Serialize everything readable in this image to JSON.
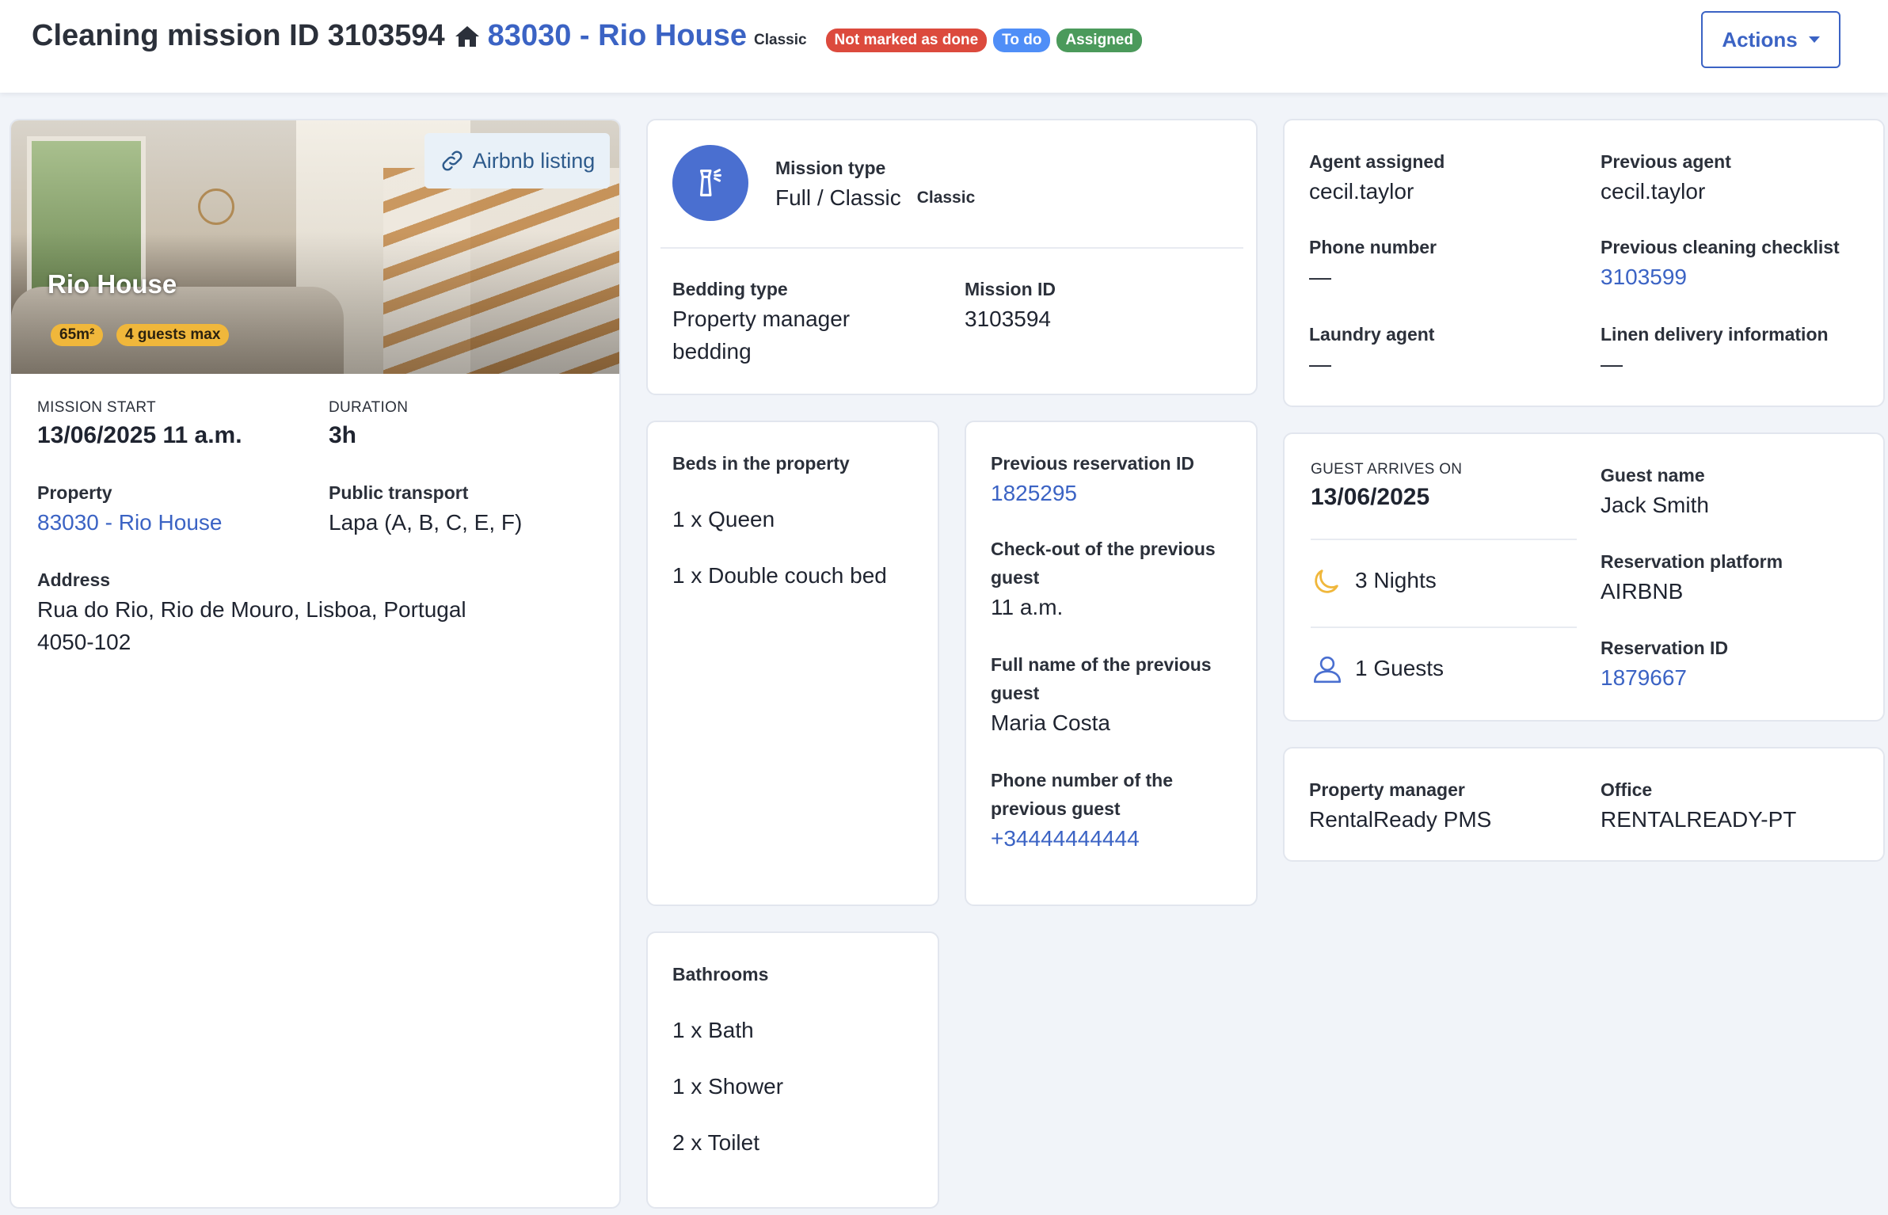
{
  "header": {
    "title": "Cleaning mission ID 3103594",
    "home_icon": "home-icon",
    "property_link": "83030 - Rio House",
    "badges": {
      "classic": "Classic",
      "not_done": "Not marked as done",
      "todo": "To do",
      "assigned": "Assigned"
    },
    "actions_label": "Actions"
  },
  "property_card": {
    "photo_title": "Rio House",
    "area": "65m²",
    "guests_max": "4 guests max",
    "airbnb_label": "Airbnb listing",
    "mission_start_label": "MISSION START",
    "mission_start": "13/06/2025 11 a.m.",
    "duration_label": "DURATION",
    "duration": "3h",
    "property_label": "Property",
    "property": "83030 - Rio House",
    "transport_label": "Public transport",
    "transport": "Lapa (A, B, C, E, F)",
    "address_label": "Address",
    "address_line1": "Rua do Rio, Rio de Mouro, Lisboa, Portugal",
    "address_line2": "4050-102"
  },
  "mission_card": {
    "type_label": "Mission type",
    "type": "Full / Classic",
    "type_chip": "Classic",
    "bedding_label": "Bedding type",
    "bedding_line1": "Property manager",
    "bedding_line2": "bedding",
    "id_label": "Mission ID",
    "id": "3103594"
  },
  "beds_card": {
    "title": "Beds in the property",
    "items": [
      "1 x Queen",
      "1 x Double couch bed"
    ]
  },
  "bathrooms_card": {
    "title": "Bathrooms",
    "items": [
      "1 x Bath",
      "1 x Shower",
      "2 x Toilet"
    ]
  },
  "prev_reservation_card": {
    "res_id_label": "Previous reservation ID",
    "res_id": "1825295",
    "checkout_label_1": "Check-out of the previous",
    "checkout_label_2": "guest",
    "checkout": "11 a.m.",
    "name_label_1": "Full name of the previous",
    "name_label_2": "guest",
    "name": "Maria Costa",
    "phone_label_1": "Phone number of the",
    "phone_label_2": "previous guest",
    "phone": "+34444444444"
  },
  "agent_card": {
    "agent_label": "Agent assigned",
    "agent": "cecil.taylor",
    "prev_agent_label": "Previous agent",
    "prev_agent": "cecil.taylor",
    "phone_label": "Phone number",
    "phone": "—",
    "checklist_label": "Previous cleaning checklist",
    "checklist": "3103599",
    "laundry_label": "Laundry agent",
    "laundry": "—",
    "linen_label": "Linen delivery information",
    "linen": "—"
  },
  "guest_card": {
    "arrives_label": "GUEST ARRIVES ON",
    "arrives": "13/06/2025",
    "nights": "3 Nights",
    "guests": "1 Guests",
    "name_label": "Guest name",
    "name": "Jack Smith",
    "platform_label": "Reservation platform",
    "platform": "AIRBNB",
    "res_id_label": "Reservation ID",
    "res_id": "1879667"
  },
  "manager_card": {
    "manager_label": "Property manager",
    "manager": "RentalReady PMS",
    "office_label": "Office",
    "office": "RENTALREADY-PT"
  },
  "colors": {
    "accent": "#3b63c4",
    "badge_red": "#dc4a3d",
    "badge_blue": "#4f8ef7",
    "badge_green": "#4b9a5b",
    "pill_yellow": "#f0b73b",
    "background": "#f1f4f9"
  }
}
